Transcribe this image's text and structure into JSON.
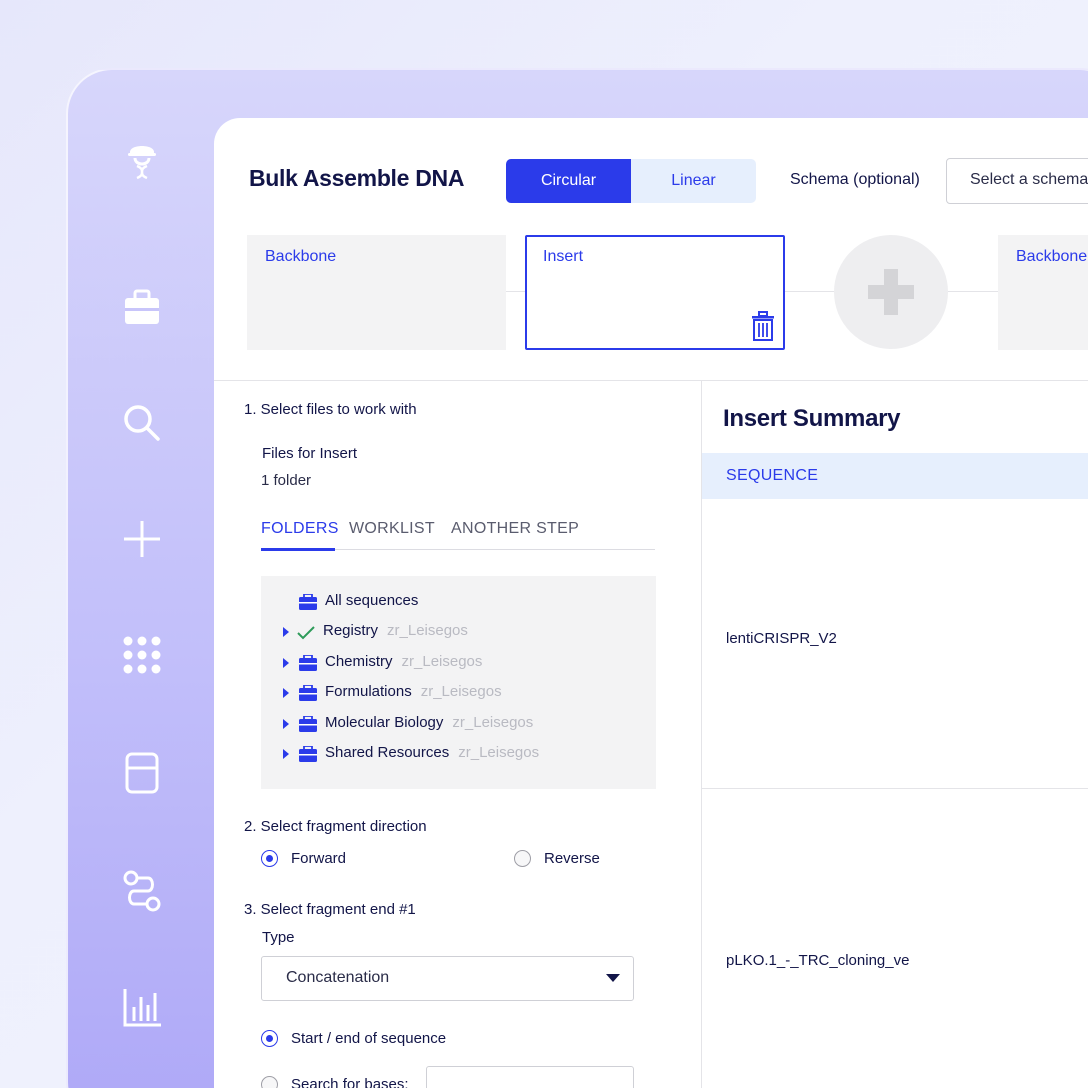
{
  "sidebar": {
    "icons": [
      "scientist-icon",
      "briefcase-icon",
      "search-icon",
      "plus-icon",
      "apps-grid-icon",
      "layout-icon",
      "workflow-icon",
      "bar-chart-icon"
    ]
  },
  "header": {
    "title": "Bulk Assemble DNA",
    "topology": {
      "options": [
        "Circular",
        "Linear"
      ],
      "selected": "Circular"
    },
    "schema_label": "Schema (optional)",
    "schema_placeholder": "Select a schema"
  },
  "fragments": [
    {
      "label": "Backbone",
      "selected": false
    },
    {
      "label": "Insert",
      "selected": true
    },
    {
      "label": "Backbone",
      "selected": false
    }
  ],
  "steps": {
    "step1": {
      "title": "1. Select files to work with",
      "files_label": "Files for Insert",
      "files_value": "1 folder",
      "tabs": [
        "FOLDERS",
        "WORKLIST",
        "ANOTHER STEP"
      ],
      "active_tab": "FOLDERS",
      "tree": {
        "root": "All sequences",
        "items": [
          {
            "name": "Registry",
            "owner": "zr_Leisegos",
            "icon": "check-icon"
          },
          {
            "name": "Chemistry",
            "owner": "zr_Leisegos",
            "icon": "briefcase-icon"
          },
          {
            "name": "Formulations",
            "owner": "zr_Leisegos",
            "icon": "briefcase-icon"
          },
          {
            "name": "Molecular Biology",
            "owner": "zr_Leisegos",
            "icon": "briefcase-icon"
          },
          {
            "name": "Shared Resources",
            "owner": "zr_Leisegos",
            "icon": "briefcase-icon"
          }
        ]
      }
    },
    "step2": {
      "title": "2. Select fragment direction",
      "options": [
        "Forward",
        "Reverse"
      ],
      "selected": "Forward"
    },
    "step3": {
      "title": "3. Select fragment end #1",
      "type_label": "Type",
      "type_value": "Concatenation",
      "end_option_1": "Start / end of sequence",
      "end_option_2": "Search for bases:",
      "selected": "Start / end of sequence"
    }
  },
  "summary": {
    "title": "Insert Summary",
    "column_header": "SEQUENCE",
    "sequences": [
      "lentiCRISPR_V2",
      "pLKO.1_-_TRC_cloning_ve"
    ]
  },
  "colors": {
    "accent": "#2b3bea",
    "accent_light": "#e6effd",
    "ink": "#121548"
  }
}
